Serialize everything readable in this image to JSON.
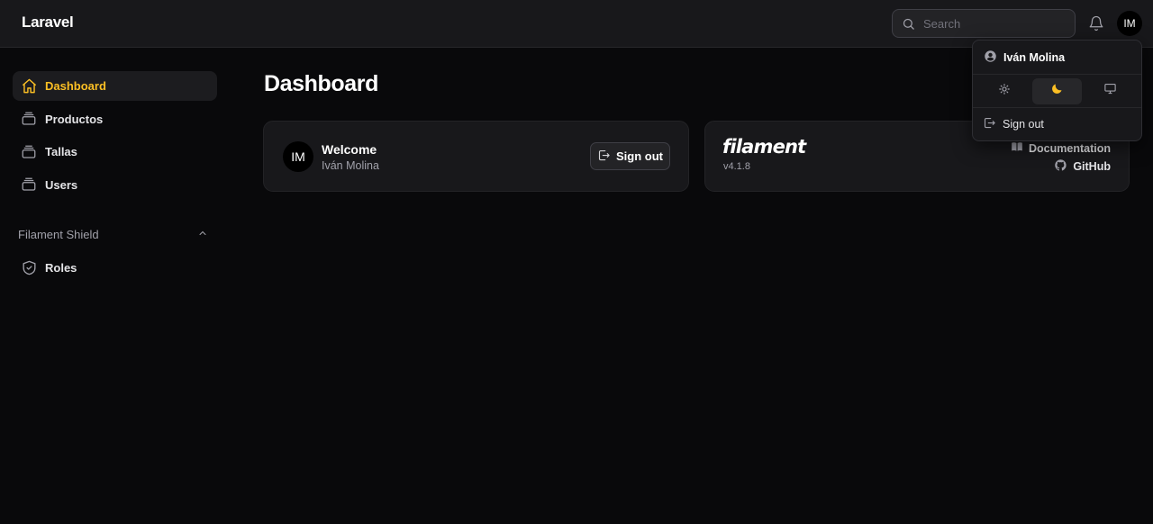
{
  "app": {
    "brand": "Laravel"
  },
  "topbar": {
    "search": {
      "placeholder": "Search",
      "value": ""
    },
    "avatar_initials": "IM"
  },
  "sidebar": {
    "items": [
      {
        "label": "Dashboard",
        "icon": "home-icon",
        "active": true
      },
      {
        "label": "Productos",
        "icon": "rectangle-stack-icon",
        "active": false
      },
      {
        "label": "Tallas",
        "icon": "rectangle-stack-icon",
        "active": false
      },
      {
        "label": "Users",
        "icon": "rectangle-stack-icon",
        "active": false
      }
    ],
    "groups": [
      {
        "label": "Filament Shield",
        "collapsed": false,
        "icon": "chevron-up-icon",
        "items": [
          {
            "label": "Roles",
            "icon": "shield-check-icon"
          }
        ]
      }
    ]
  },
  "main": {
    "title": "Dashboard",
    "welcome_card": {
      "avatar_initials": "IM",
      "title": "Welcome",
      "user_name": "Iván Molina",
      "signout_label": "Sign out"
    },
    "filament_card": {
      "logo_text": "filament",
      "version": "v4.1.8",
      "links": [
        {
          "label": "Documentation",
          "icon": "book-open-icon"
        },
        {
          "label": "GitHub",
          "icon": "github-icon"
        }
      ]
    }
  },
  "user_menu": {
    "user_name": "Iván Molina",
    "theme_options": [
      {
        "name": "light",
        "icon": "sun-icon",
        "active": false
      },
      {
        "name": "dark",
        "icon": "moon-icon",
        "active": true
      },
      {
        "name": "system",
        "icon": "computer-desktop-icon",
        "active": false
      }
    ],
    "signout_label": "Sign out"
  },
  "colors": {
    "accent": "#fbbf24",
    "background": "#09090b",
    "surface": "#18181b",
    "text_muted": "#a1a1aa"
  }
}
